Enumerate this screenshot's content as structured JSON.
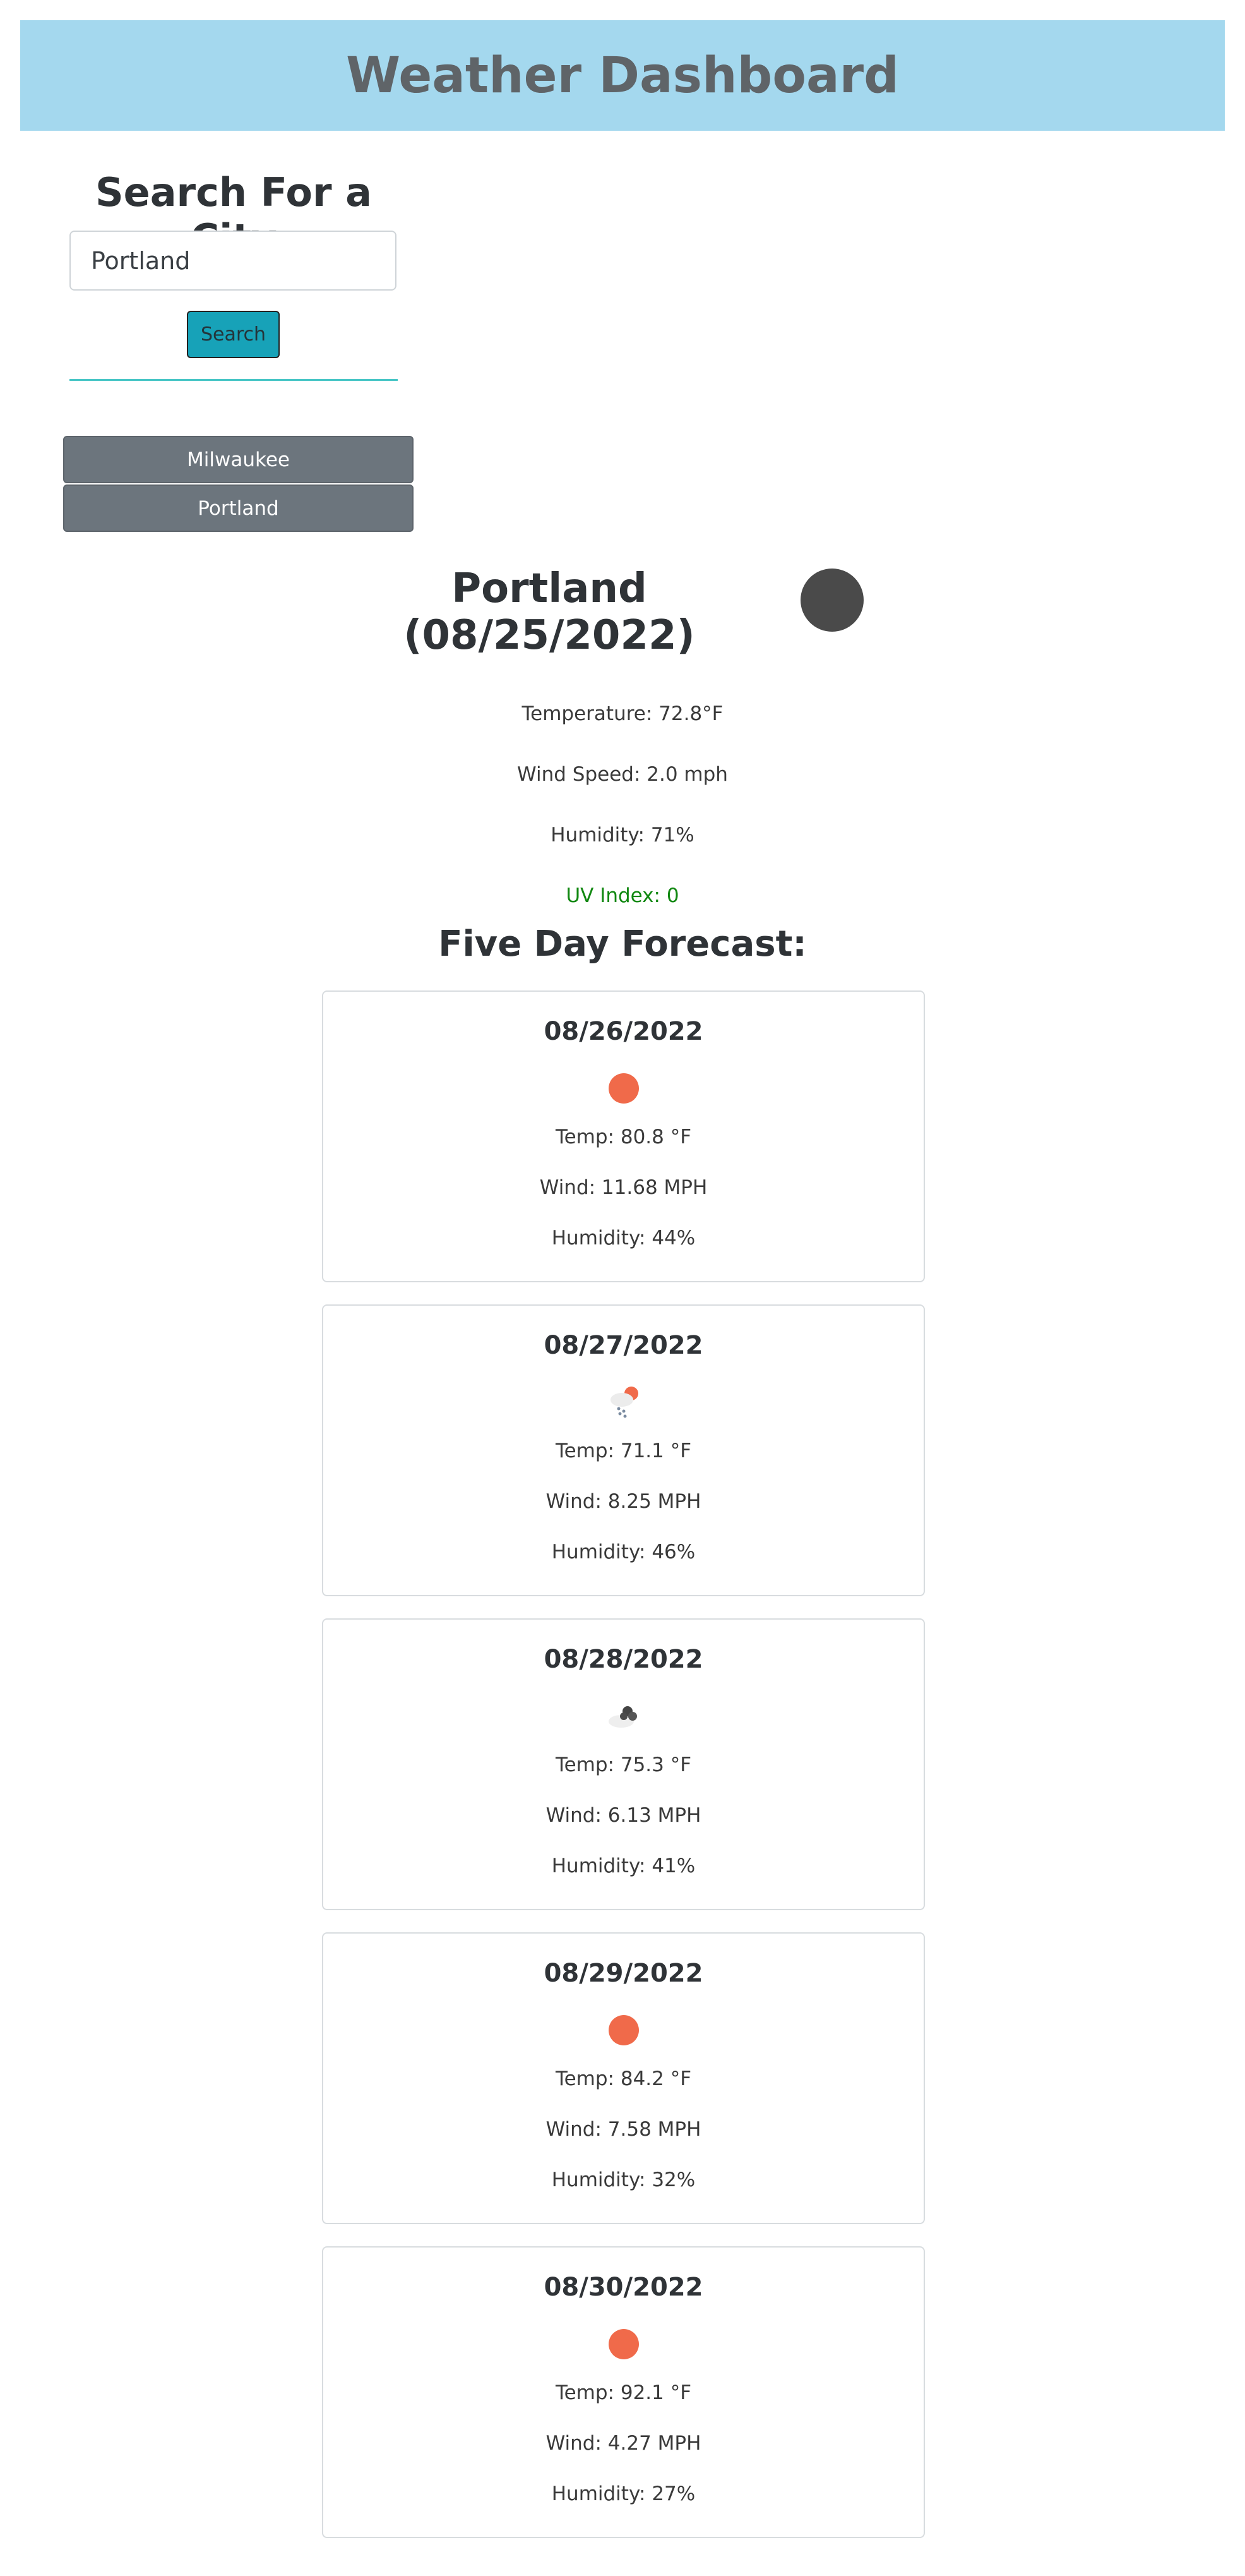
{
  "header": {
    "title": "Weather Dashboard"
  },
  "search": {
    "title": "Search For a City",
    "input_value": "Portland",
    "button_label": "Search"
  },
  "history": [
    {
      "label": "Milwaukee"
    },
    {
      "label": "Portland"
    }
  ],
  "current": {
    "title": "Portland (08/25/2022)",
    "icon": "dark-circle-icon",
    "temperature": "Temperature: 72.8°F",
    "wind": "Wind Speed: 2.0 mph",
    "humidity": "Humidity: 71%",
    "uv": "UV Index: 0",
    "uv_color": "#118811"
  },
  "forecast": {
    "title": "Five Day Forecast:",
    "days": [
      {
        "date": "08/26/2022",
        "icon": "sun-icon",
        "temp": "Temp: 80.8 °F",
        "wind": "Wind: 11.68 MPH",
        "humidity": "Humidity: 44%"
      },
      {
        "date": "08/27/2022",
        "icon": "rain-sun-icon",
        "temp": "Temp: 71.1 °F",
        "wind": "Wind: 8.25 MPH",
        "humidity": "Humidity: 46%"
      },
      {
        "date": "08/28/2022",
        "icon": "cloudy-icon",
        "temp": "Temp: 75.3 °F",
        "wind": "Wind: 6.13 MPH",
        "humidity": "Humidity: 41%"
      },
      {
        "date": "08/29/2022",
        "icon": "sun-icon",
        "temp": "Temp: 84.2 °F",
        "wind": "Wind: 7.58 MPH",
        "humidity": "Humidity: 32%"
      },
      {
        "date": "08/30/2022",
        "icon": "sun-icon",
        "temp": "Temp: 92.1 °F",
        "wind": "Wind: 4.27 MPH",
        "humidity": "Humidity: 27%"
      }
    ]
  },
  "colors": {
    "header_bg": "#a4d8ee",
    "button_primary": "#17a2b8",
    "button_secondary": "#6c757d",
    "sun": "#f06a4a"
  }
}
